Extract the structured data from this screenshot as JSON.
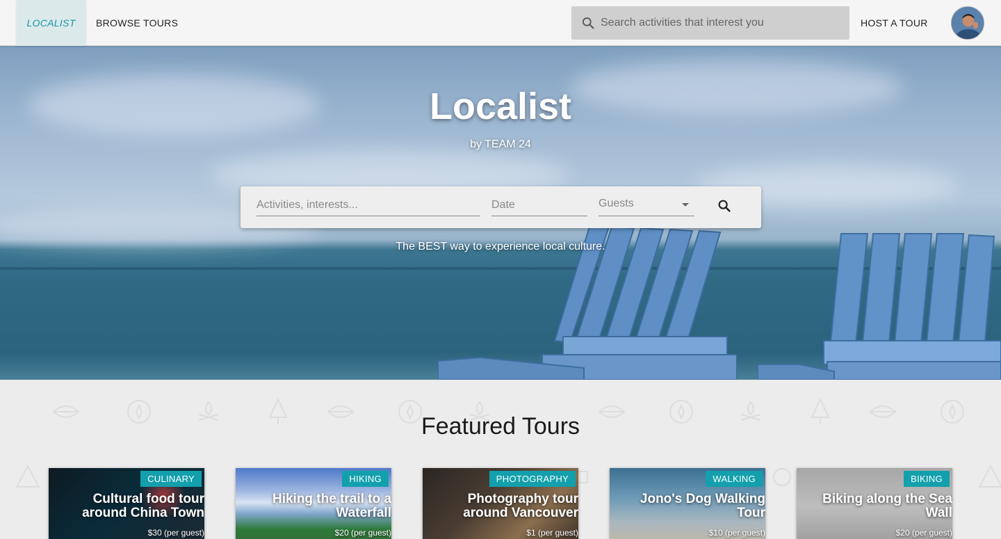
{
  "navbar": {
    "brand": "LOCALIST",
    "browse_label": "BROWSE TOURS",
    "search_placeholder": "Search activities that interest you",
    "host_label": "HOST A TOUR",
    "avatar_icon": "user-avatar"
  },
  "hero": {
    "title": "Localist",
    "subtitle": "by TEAM 24",
    "tagline": "The BEST way to experience local culture.",
    "search": {
      "activities_placeholder": "Activities, interests...",
      "date_placeholder": "Date",
      "guests_label": "Guests",
      "search_icon": "search-icon",
      "dropdown_icon": "caret-down-icon"
    }
  },
  "featured": {
    "title": "Featured Tours",
    "tours": [
      {
        "category": "CULINARY",
        "title": "Cultural food tour around China Town",
        "price": "$30 (per guest)"
      },
      {
        "category": "HIKING",
        "title": "Hiking the trail to a Waterfall",
        "price": "$20 (per guest)"
      },
      {
        "category": "PHOTOGRAPHY",
        "title": "Photography tour around Vancouver",
        "price": "$1 (per guest)"
      },
      {
        "category": "WALKING",
        "title": "Jono's Dog Walking Tour",
        "price": "$10 (per guest)"
      },
      {
        "category": "BIKING",
        "title": "Biking along the Sea Wall",
        "price": "$20 (per guest)"
      }
    ]
  },
  "colors": {
    "accent": "#13a0ac",
    "brand_text": "#1796a3",
    "navbar_bg": "#f5f5f5"
  }
}
